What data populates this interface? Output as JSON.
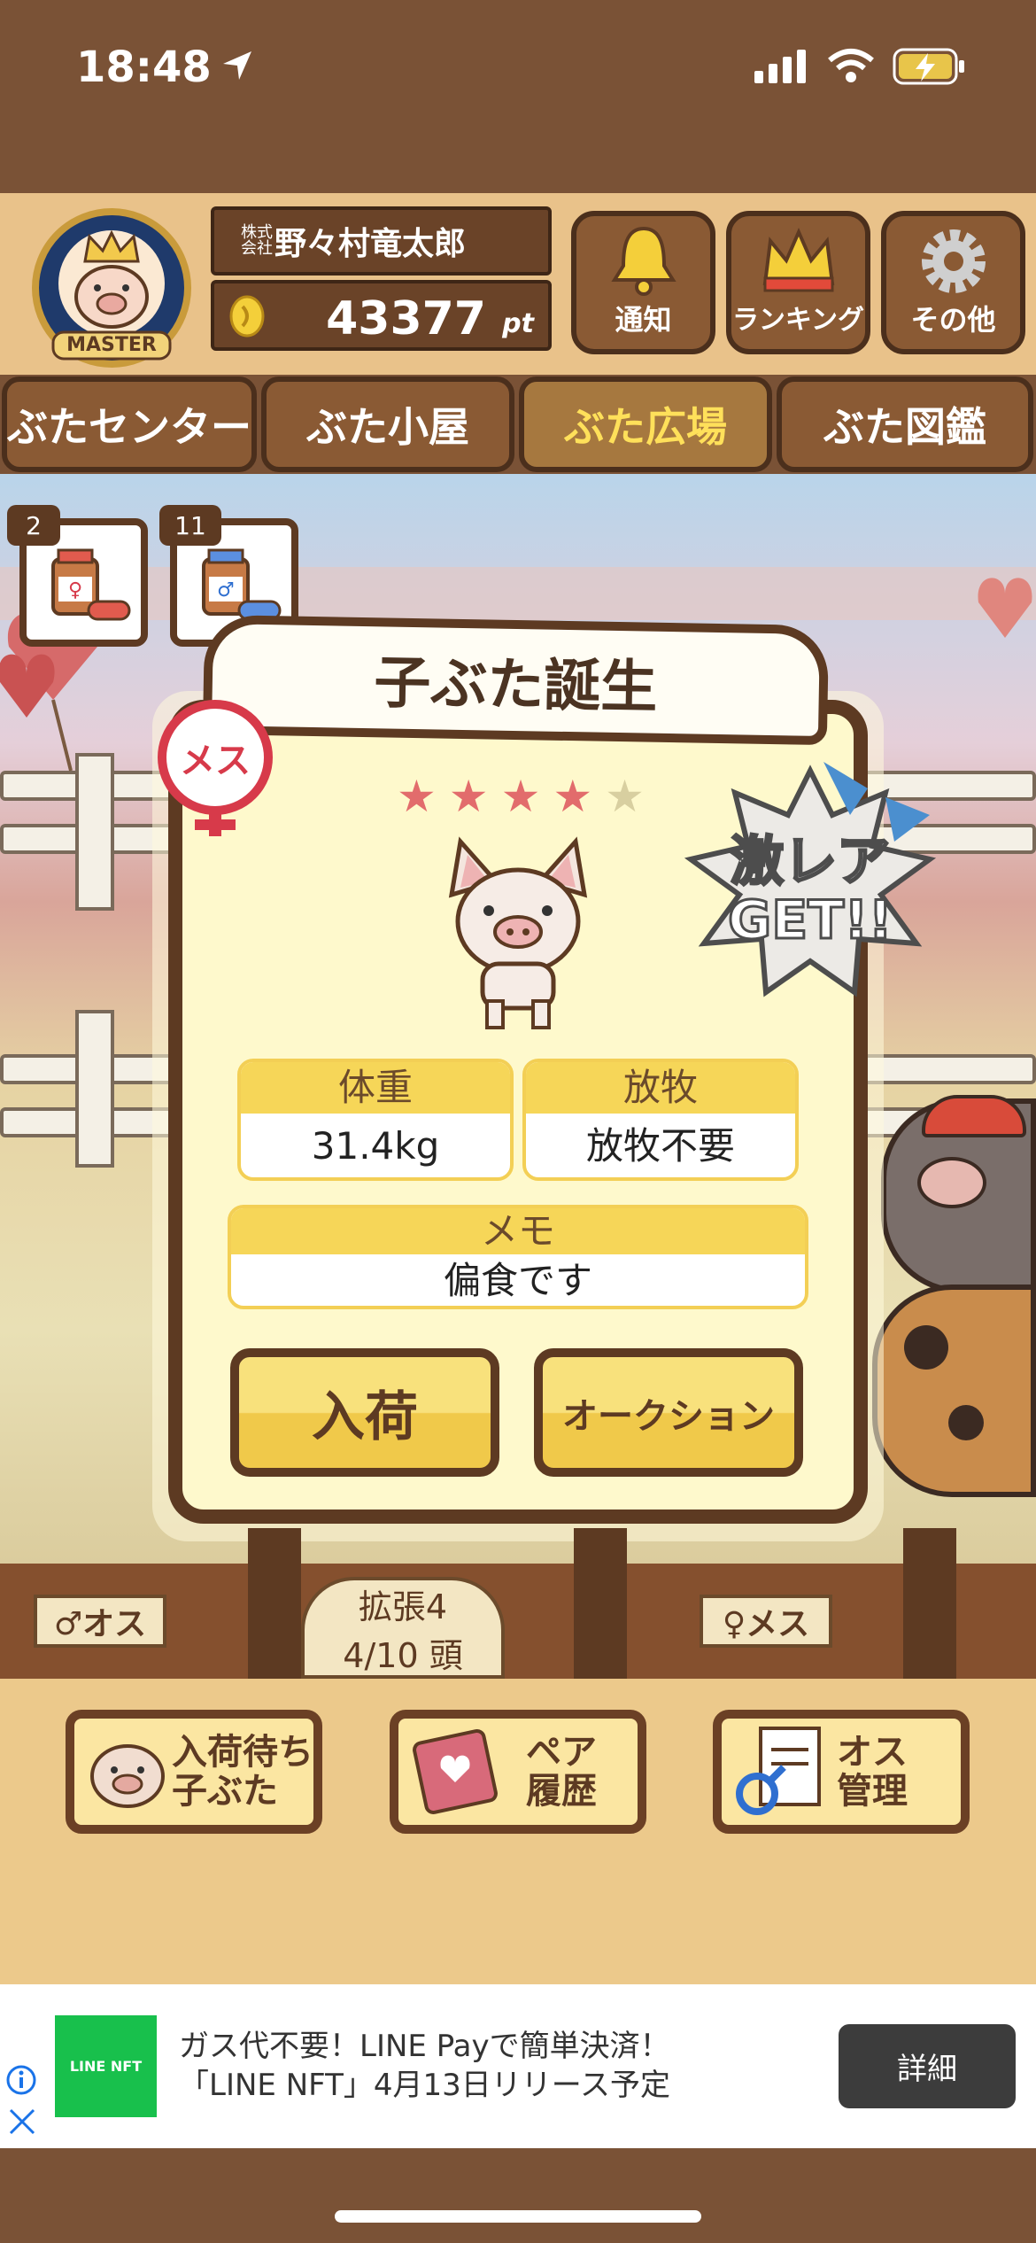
{
  "status_bar": {
    "time": "18:48"
  },
  "player": {
    "badge_text": "MASTER",
    "company_prefix": "株式会社",
    "name": "野々村竜太郎",
    "points": "43377",
    "points_unit": "pt"
  },
  "header_buttons": {
    "notification": "通知",
    "ranking": "ランキング",
    "other": "その他"
  },
  "tabs": [
    {
      "label": "ぶたセンター"
    },
    {
      "label": "ぶた小屋"
    },
    {
      "label": "ぶた広場"
    },
    {
      "label": "ぶた図鑑"
    }
  ],
  "items": {
    "female_medicine_count": "2",
    "male_medicine_count": "11"
  },
  "modal": {
    "title": "子ぶた誕生",
    "gender_label": "メス",
    "rare_label_line1": "激レア",
    "rare_label_line2": "GET!!",
    "stars_filled": 4,
    "stars_total": 5,
    "weight_label": "体重",
    "weight_value": "31.4kg",
    "grazing_label": "放牧",
    "grazing_value": "放牧不要",
    "memo_label": "メモ",
    "memo_value": "偏食です",
    "receive_button": "入荷",
    "auction_button": "オークション"
  },
  "farm": {
    "male_sign": "♂オス",
    "female_sign": "♀メス",
    "expansion_label": "拡張4",
    "capacity": "4/10 頭"
  },
  "bottom_buttons": {
    "waiting_line1": "入荷待ち",
    "waiting_line2": "子ぶた",
    "pair_line1": "ペア",
    "pair_line2": "履歴",
    "male_line1": "オス",
    "male_line2": "管理"
  },
  "ad": {
    "logo": "LINE NFT",
    "line1": "ガス代不要！LINE Payで簡単決済！",
    "line2": "「LINE NFT」4月13日リリース予定",
    "button": "詳細"
  },
  "colors": {
    "wood_dark": "#5d3a22",
    "gold": "#f6d658",
    "female_red": "#d73a4a",
    "male_blue": "#2f6fd0",
    "ad_green": "#18c04c"
  }
}
